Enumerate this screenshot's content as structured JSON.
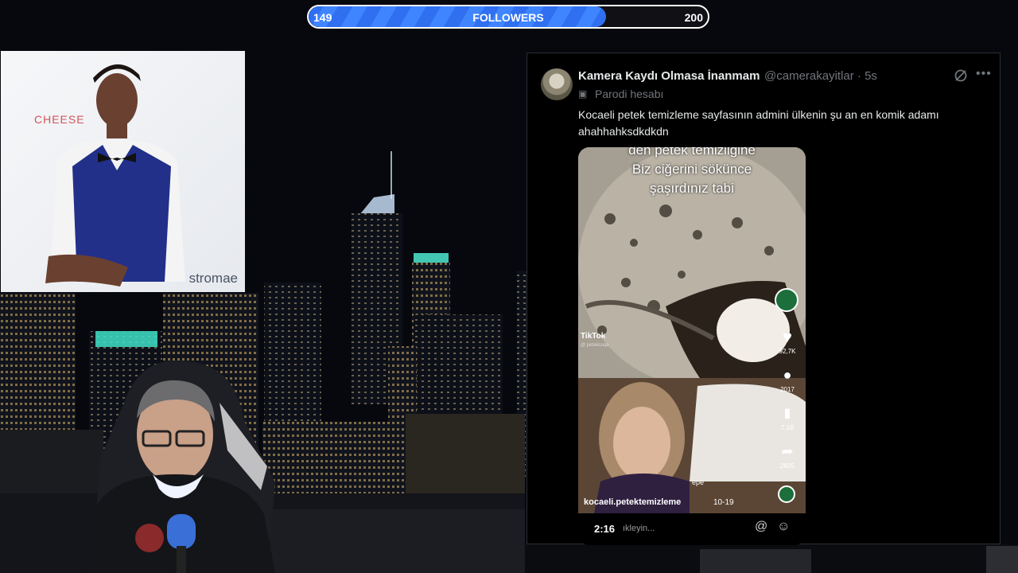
{
  "goal": {
    "current": "149",
    "label": "FOLLOWERS",
    "target": "200",
    "progress": 0.745,
    "fill_color": "#3a7cf8"
  },
  "album": {
    "word": "CHEESE",
    "artist": "stromae"
  },
  "tweet": {
    "author_name": "Kamera Kaydı Olmasa İnanmam",
    "author_meta": "@camerakayitlar · 5s",
    "parody_label": "Parodi hesabı",
    "text": "Kocaeli petek temizleme sayfasının admini ülkenin şu an en komik adamı ahahhahksdkdkdn",
    "video": {
      "caption": [
        "den petek temizliğine",
        "Biz ciğerini sökünce",
        "şaşırdınız tabi"
      ],
      "tiktok": "TikTok",
      "tiktok_user": "@ petekcuqa",
      "likes": "92,7K",
      "comments": "2017",
      "saves": "7.1B",
      "shares": "2605",
      "tag": "epe",
      "creator": "kocaeli.petektemizleme",
      "date": "10-19",
      "time": "2:16",
      "subtitle": "ıkleyin..."
    }
  },
  "colors": {
    "panel_bg": "#000000",
    "text": "#e7e9ea",
    "muted": "#71767b"
  },
  "icons": {
    "parody": "mask-icon",
    "grok": "grok-icon",
    "more": "more-icon",
    "like": "heart-icon",
    "comment": "comment-icon",
    "save": "bookmark-icon",
    "share": "share-icon"
  }
}
